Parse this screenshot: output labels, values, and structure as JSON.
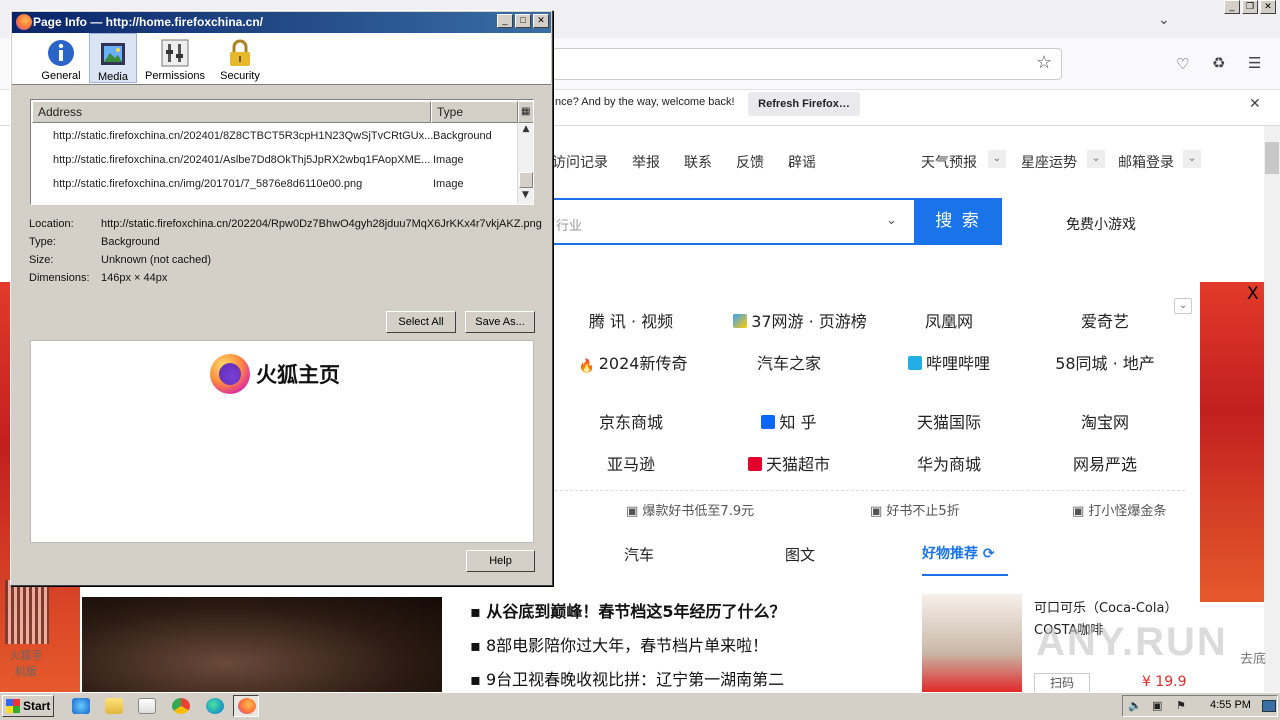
{
  "browser": {
    "notification": {
      "text": "nce? And by the way, welcome back!",
      "button": "Refresh Firefox…"
    }
  },
  "page": {
    "top_links": [
      "访问记录",
      "举报",
      "联系",
      "反馈",
      "辟谣"
    ],
    "dropdowns": [
      "天气预报",
      "星座运势",
      "邮箱登录"
    ],
    "search": {
      "placeholder": "行业",
      "button": "搜 索"
    },
    "free_games": "免费小游戏",
    "close": "X",
    "sites": [
      [
        "腾 讯 · 视频",
        "37网游 · 页游榜",
        "凤凰网",
        "爱奇艺"
      ],
      [
        "2024新传奇",
        "汽车之家",
        "哔哩哔哩",
        "58同城 · 地产"
      ],
      [
        "京东商城",
        "知 乎",
        "天猫国际",
        "淘宝网"
      ],
      [
        "亚马逊",
        "天猫超市",
        "华为商城",
        "网易严选"
      ]
    ],
    "promos": [
      "爆款好书低至7.9元",
      "好书不止5折",
      "打小怪爆金条"
    ],
    "category_tabs": [
      "汽车",
      "图文"
    ],
    "hot": {
      "title": "好物推荐"
    },
    "news": [
      "从谷底到巅峰！春节档这5年经历了什么？",
      "8部电影陪你过大年，春节档片单来啦！",
      "9台卫视春晚收视比拼：辽宁第一湖南第二"
    ],
    "product": {
      "title": "可口可乐（Coca-Cola）COSTA咖啡",
      "scan": "扫码",
      "price": "¥ 19.9"
    },
    "side": {
      "qr_label": "火狐手机版",
      "bg_label": "去底"
    },
    "watermark": "ANY.RUN"
  },
  "dialog": {
    "title": "Page Info — http://home.firefoxchina.cn/",
    "tabs": {
      "general": "General",
      "media": "Media",
      "permissions": "Permissions",
      "security": "Security"
    },
    "columns": {
      "address": "Address",
      "type": "Type"
    },
    "rows": [
      {
        "address": "http://static.firefoxchina.cn/202401/8Z8CTBCT5R3cpH1N23QwSjTvCRtGUx...",
        "type": "Background"
      },
      {
        "address": "http://static.firefoxchina.cn/202401/Aslbe7Dd8OkThj5JpRX2wbq1FAopXME...",
        "type": "Image"
      },
      {
        "address": "http://static.firefoxchina.cn/img/201701/7_5876e8d6110e00.png",
        "type": "Image"
      }
    ],
    "details": {
      "location_label": "Location:",
      "location": "http://static.firefoxchina.cn/202204/Rpw0Dz7BhwO4gyh28jduu7MqX6JrKKx4r7vkjAKZ.png",
      "type_label": "Type:",
      "type": "Background",
      "size_label": "Size:",
      "size": "Unknown (not cached)",
      "dimensions_label": "Dimensions:",
      "dimensions": "146px × 44px"
    },
    "buttons": {
      "select_all": "Select All",
      "save_as": "Save As...",
      "help": "Help"
    },
    "preview_text": "火狐主页"
  },
  "taskbar": {
    "start": "Start",
    "clock": "4:55 PM"
  }
}
